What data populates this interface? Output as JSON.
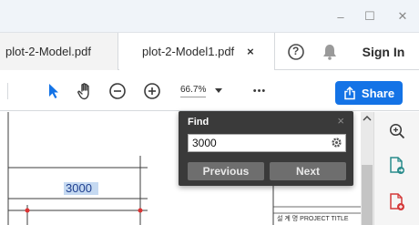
{
  "window": {
    "minimize_glyph": "–",
    "maximize_glyph": "☐",
    "close_glyph": "✕"
  },
  "tabs": [
    {
      "label": "plot-2-Model.pdf",
      "active": false
    },
    {
      "label": "plot-2-Model1.pdf",
      "active": true,
      "close_glyph": "×"
    }
  ],
  "header": {
    "help_glyph": "?",
    "signin_label": "Sign In"
  },
  "toolbar": {
    "zoom_value": "66.7%",
    "more_glyph": "•••",
    "share_label": "Share"
  },
  "find": {
    "title": "Find",
    "close_glyph": "×",
    "query": "3000",
    "previous_label": "Previous",
    "next_label": "Next"
  },
  "drawing": {
    "dimension_text": "3000",
    "title_block_text": "설 계 명 PROJECT TITLE"
  },
  "colors": {
    "accent": "#1473e6",
    "pointer_blue": "#1473e6",
    "highlight": "#c5d9f1",
    "find_panel_bg": "#3a3a3a"
  }
}
